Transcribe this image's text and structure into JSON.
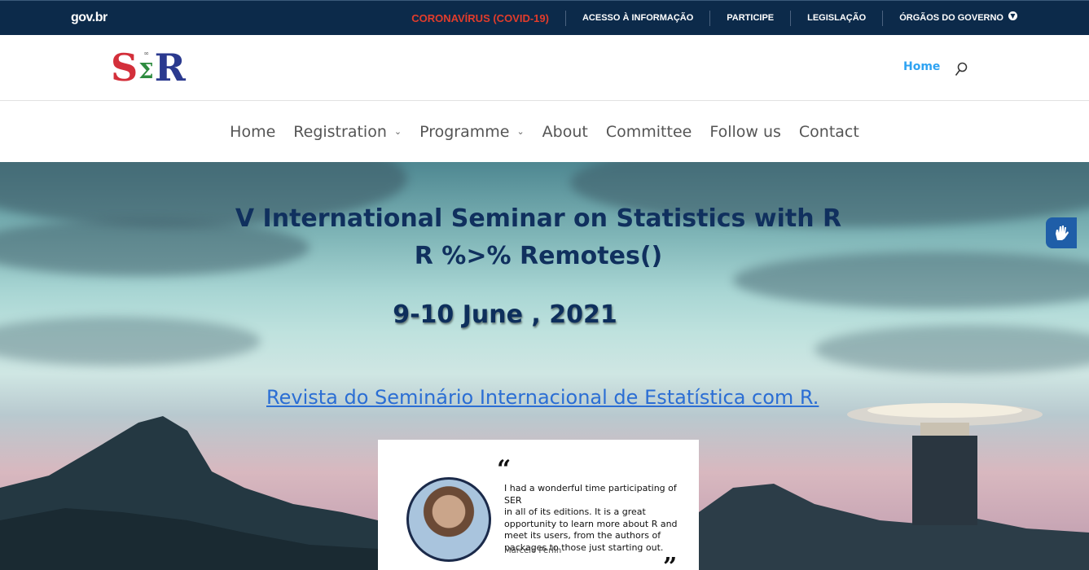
{
  "govbar": {
    "logo": "gov.br",
    "links": [
      {
        "label": "CORONAVÍRUS (COVID-19)"
      },
      {
        "label": "ACESSO À INFORMAÇÃO"
      },
      {
        "label": "PARTICIPE"
      },
      {
        "label": "LEGISLAÇÃO"
      },
      {
        "label": "ÓRGÃOS DO GOVERNO"
      }
    ],
    "covid_color": "#e23c2b",
    "background": "#0c2a4a"
  },
  "header": {
    "logo": {
      "s": "S",
      "sigma": "Σ",
      "r": "R",
      "sigma_small": "∞"
    },
    "home_link": "Home",
    "search_icon": "search-icon",
    "accent": "#2ea3f2"
  },
  "nav": {
    "items": [
      {
        "label": "Home"
      },
      {
        "label": "Registration",
        "caret": "⌄"
      },
      {
        "label": "Programme",
        "caret": "⌄"
      },
      {
        "label": "About"
      },
      {
        "label": "Committee"
      },
      {
        "label": "Follow us"
      },
      {
        "label": "Contact"
      }
    ]
  },
  "hero": {
    "title_line1": "V International Seminar on Statistics with R",
    "title_line2": "R %>% Remotes()",
    "date": "9-10 June , 2021",
    "revista_link": "Revista do Seminário Internacional de Estatística com R."
  },
  "testimonial": {
    "quote_open": "“",
    "quote_close": "”",
    "lines": [
      "I had a wonderful time participating of SER",
      "in all of its editions. It is a great",
      "opportunity to learn more about R and",
      "meet its users, from the authors of",
      "packages to those just starting out."
    ],
    "author": "Marcelo Perlin"
  },
  "accessibility": {
    "icon": "sign-language-hand-icon"
  }
}
